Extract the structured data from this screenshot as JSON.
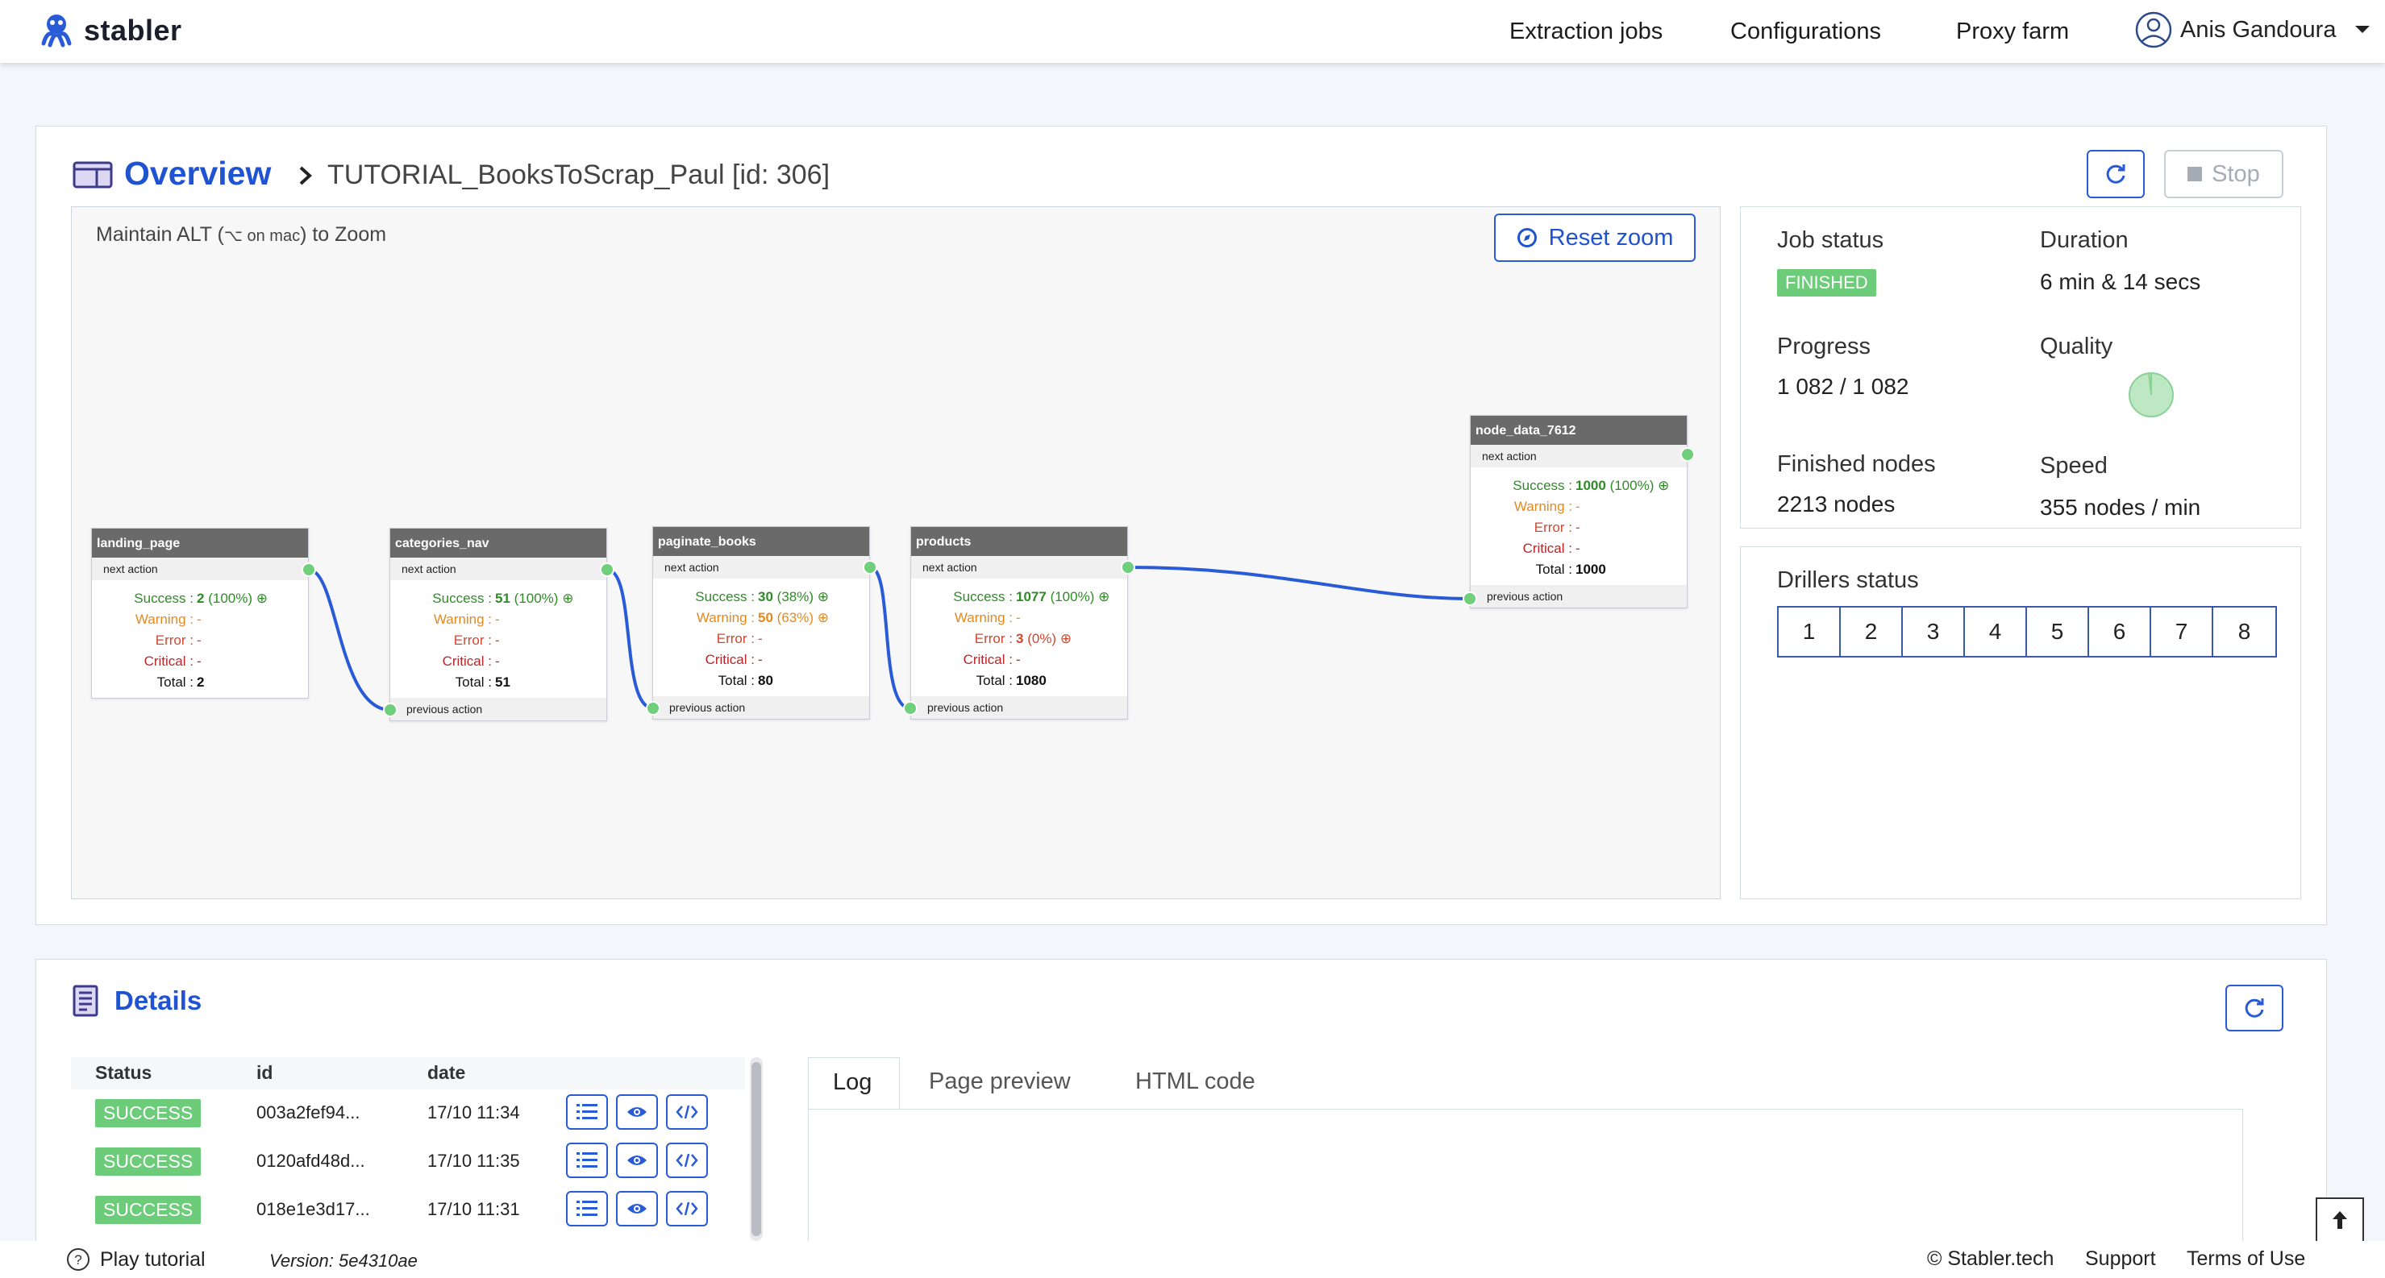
{
  "brand": {
    "name": "stabler"
  },
  "nav": {
    "extraction_jobs": "Extraction jobs",
    "configurations": "Configurations",
    "proxy_farm": "Proxy farm",
    "user_name": "Anis Gandoura"
  },
  "overview": {
    "title": "Overview",
    "job_name": "TUTORIAL_BooksToScrap_Paul [id: 306]",
    "stop_label": "Stop",
    "zoom_hint_prefix": "Maintain ALT (",
    "zoom_hint_key": "⌥ on mac",
    "zoom_hint_suffix": ") to Zoom",
    "reset_zoom_label": "Reset zoom"
  },
  "nodes": [
    {
      "name": "landing_page",
      "next": "next action",
      "prev": "",
      "success": "2",
      "success_pct": "(100%)",
      "warning": "-",
      "warning_pct": "",
      "error": "-",
      "error_pct": "",
      "critical": "-",
      "total": "2"
    },
    {
      "name": "categories_nav",
      "next": "next action",
      "prev": "previous action",
      "success": "51",
      "success_pct": "(100%)",
      "warning": "-",
      "warning_pct": "",
      "error": "-",
      "error_pct": "",
      "critical": "-",
      "total": "51"
    },
    {
      "name": "paginate_books",
      "next": "next action",
      "prev": "previous action",
      "success": "30",
      "success_pct": "(38%)",
      "warning": "50",
      "warning_pct": "(63%)",
      "error": "-",
      "error_pct": "",
      "critical": "-",
      "total": "80"
    },
    {
      "name": "products",
      "next": "next action",
      "prev": "previous action",
      "success": "1077",
      "success_pct": "(100%)",
      "warning": "-",
      "warning_pct": "",
      "error": "3",
      "error_pct": "(0%)",
      "critical": "-",
      "total": "1080"
    },
    {
      "name": "node_data_7612",
      "next": "next action",
      "prev": "previous action",
      "success": "1000",
      "success_pct": "(100%)",
      "warning": "-",
      "warning_pct": "",
      "error": "-",
      "error_pct": "",
      "critical": "-",
      "total": "1000"
    }
  ],
  "labels": {
    "success": "Success :",
    "warning": "Warning :",
    "error": "Error :",
    "critical": "Critical :",
    "total": "Total :"
  },
  "status": {
    "job_status_label": "Job status",
    "job_status": "FINISHED",
    "duration_label": "Duration",
    "duration": "6 min & 14 secs",
    "progress_label": "Progress",
    "progress": "1 082 / 1 082",
    "quality_label": "Quality",
    "quality_ratio": 0.98,
    "finished_nodes_label": "Finished nodes",
    "finished_nodes": "2213 nodes",
    "speed_label": "Speed",
    "speed": "355 nodes / min",
    "drillers_label": "Drillers status",
    "drillers": [
      "1",
      "2",
      "3",
      "4",
      "5",
      "6",
      "7",
      "8"
    ]
  },
  "details": {
    "title": "Details",
    "columns": {
      "status": "Status",
      "id": "id",
      "date": "date"
    },
    "rows": [
      {
        "status": "SUCCESS",
        "id": "003a2fef94...",
        "date": "17/10 11:34"
      },
      {
        "status": "SUCCESS",
        "id": "0120afd48d...",
        "date": "17/10 11:35"
      },
      {
        "status": "SUCCESS",
        "id": "018e1e3d17...",
        "date": "17/10 11:31"
      }
    ],
    "tabs": {
      "log": "Log",
      "preview": "Page preview",
      "html": "HTML code"
    }
  },
  "footer": {
    "tutorial": "Play tutorial",
    "version": "Version: 5e4310ae",
    "copyright": "© Stabler.tech",
    "support": "Support",
    "terms": "Terms of Use"
  },
  "colors": {
    "accent": "#1f53d1",
    "success": "#6ccc7a",
    "edge": "#2a5bd7"
  }
}
